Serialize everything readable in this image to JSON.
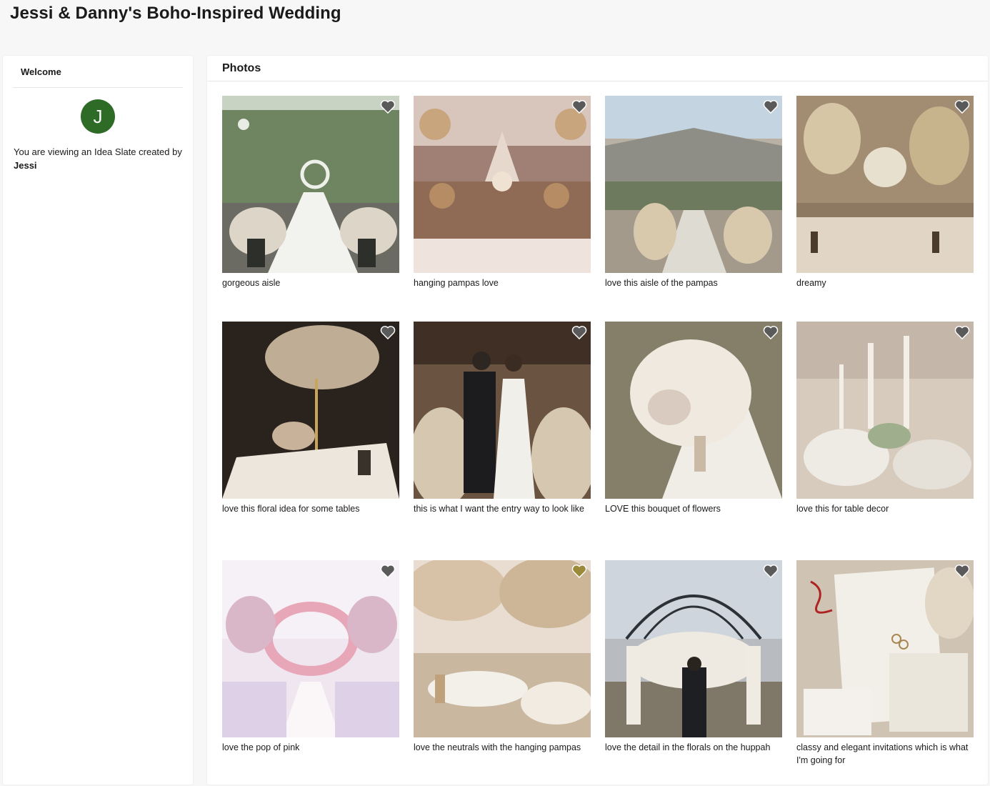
{
  "page": {
    "title": "Jessi & Danny's Boho-Inspired Wedding"
  },
  "sidebar": {
    "heading": "Welcome",
    "avatar_initial": "J",
    "avatar_color": "#2e6b27",
    "viewing_text": "You are viewing an Idea Slate created by",
    "creator": "Jessi"
  },
  "main": {
    "heading": "Photos",
    "photos": [
      {
        "caption": "gorgeous aisle",
        "favorited": false
      },
      {
        "caption": "hanging pampas love",
        "favorited": false
      },
      {
        "caption": "love this aisle of the pampas",
        "favorited": false
      },
      {
        "caption": "dreamy",
        "favorited": false
      },
      {
        "caption": "love this floral idea for some tables",
        "favorited": false
      },
      {
        "caption": "this is what I want the entry way to look like",
        "favorited": false
      },
      {
        "caption": "LOVE this bouquet of flowers",
        "favorited": false
      },
      {
        "caption": "love this for table decor",
        "favorited": false
      },
      {
        "caption": "love the pop of pink",
        "favorited": false
      },
      {
        "caption": "love the neutrals with the hanging pampas",
        "favorited": true
      },
      {
        "caption": "love the detail in the florals on the huppah",
        "favorited": false
      },
      {
        "caption": "classy and elegant invitations which is what I'm going for",
        "favorited": false
      }
    ]
  },
  "colors": {
    "heart_default": "#5a5a5a",
    "heart_favorited": "#9a8a3a"
  }
}
